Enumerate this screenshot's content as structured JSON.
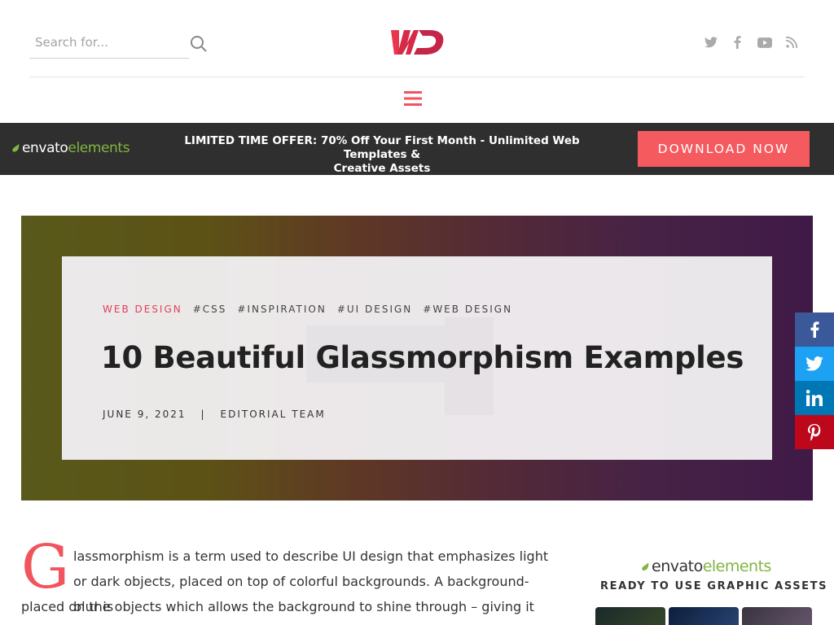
{
  "header": {
    "search_placeholder": "Search for...",
    "logo_text": "WD",
    "social_icons": [
      "twitter-icon",
      "facebook-icon",
      "youtube-icon",
      "rss-icon"
    ]
  },
  "promo": {
    "brand_part1": "envato",
    "brand_part2": "elements",
    "text_line1": "LIMITED TIME OFFER: 70% Off Your First Month - Unlimited Web Templates &",
    "text_line2": "Creative Assets",
    "button_label": "DOWNLOAD NOW"
  },
  "hero": {
    "category": "WEB DESIGN",
    "tags": [
      "#CSS",
      "#INSPIRATION",
      "#UI DESIGN",
      "#WEB DESIGN"
    ],
    "title": "10 Beautiful Glassmorphism Examples",
    "date": "JUNE 9, 2021",
    "separator": "|",
    "author": "EDITORIAL TEAM"
  },
  "share": [
    "facebook-icon",
    "twitter-icon",
    "linkedin-icon",
    "pinterest-icon"
  ],
  "article": {
    "dropcap": "G",
    "line1": "lassmorphism is a term used to describe UI design that emphasizes light or dark objects, placed on top of colorful backgrounds. A background-blur is",
    "line2": "placed on the objects which allows the background to shine through – giving it the"
  },
  "sidebar_ad": {
    "brand_part1": "envato",
    "brand_part2": "elements",
    "caption": "READY TO USE GRAPHIC ASSETS"
  },
  "colors": {
    "accent": "#f55a5e",
    "promo_bg": "#2f2f2f",
    "envato_green": "#82b541"
  }
}
